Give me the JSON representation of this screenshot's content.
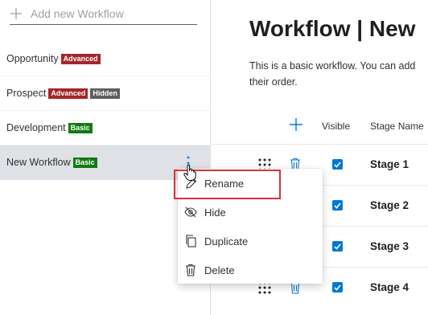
{
  "sidebar": {
    "add_placeholder": "Add new Workflow",
    "items": [
      {
        "label": "Opportunity",
        "badges": [
          {
            "text": "Advanced",
            "color": "#a4262c"
          }
        ]
      },
      {
        "label": "Prospect",
        "badges": [
          {
            "text": "Advanced",
            "color": "#a4262c"
          },
          {
            "text": "Hidden",
            "color": "#605e5c"
          }
        ]
      },
      {
        "label": "Development",
        "badges": [
          {
            "text": "Basic",
            "color": "#107c10"
          }
        ]
      },
      {
        "label": "New Workflow",
        "badges": [
          {
            "text": "Basic",
            "color": "#107c10"
          }
        ],
        "selected": true
      }
    ]
  },
  "main": {
    "title": "Workflow | New",
    "description": "This is a basic workflow. You can add their order.",
    "columns": {
      "visible": "Visible",
      "stage_name": "Stage Name"
    },
    "stages": [
      {
        "name": "Stage 1",
        "visible": true
      },
      {
        "name": "Stage 2",
        "visible": true
      },
      {
        "name": "Stage 3",
        "visible": true
      },
      {
        "name": "Stage 4",
        "visible": true
      }
    ]
  },
  "context_menu": {
    "items": [
      {
        "label": "Rename",
        "icon": "rename-icon"
      },
      {
        "label": "Hide",
        "icon": "hide-icon"
      },
      {
        "label": "Duplicate",
        "icon": "duplicate-icon"
      },
      {
        "label": "Delete",
        "icon": "delete-icon"
      }
    ],
    "highlighted": "Rename"
  },
  "colors": {
    "accent": "#0078d4",
    "badge_advanced": "#a4262c",
    "badge_hidden": "#605e5c",
    "badge_basic": "#107c10",
    "highlight_box": "#d0343c"
  }
}
